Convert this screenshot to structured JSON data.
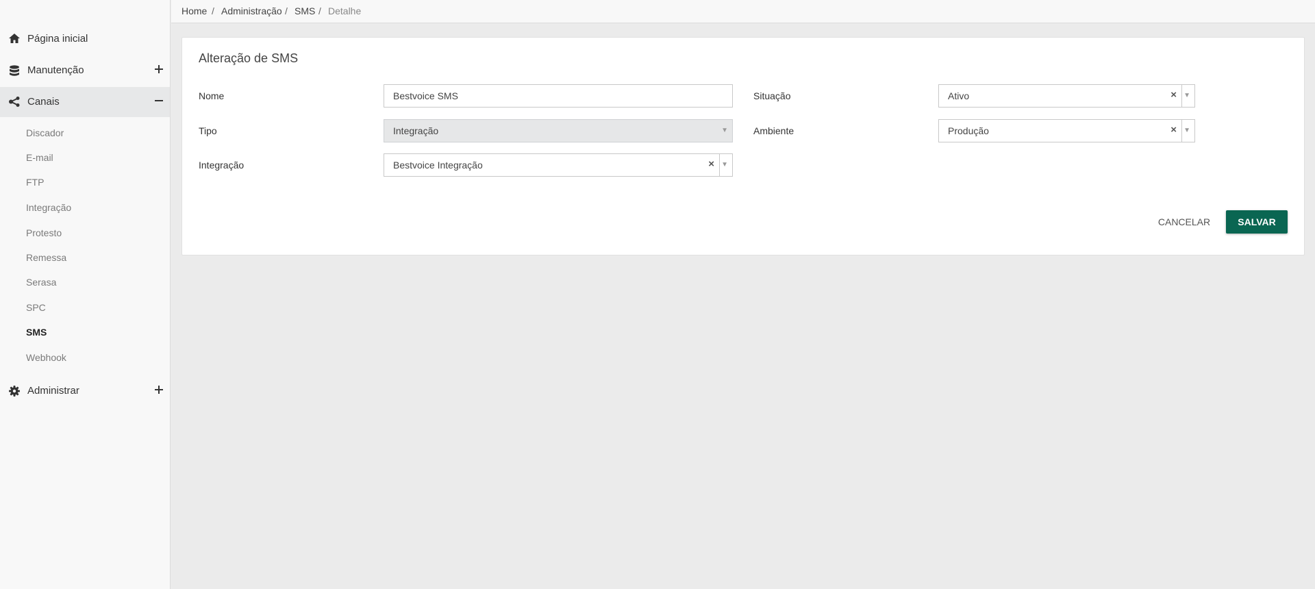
{
  "sidebar": {
    "home": {
      "label": "Página inicial",
      "icon": "home-icon"
    },
    "manutencao": {
      "label": "Manutenção",
      "icon": "database-icon"
    },
    "canais": {
      "label": "Canais",
      "icon": "share-icon"
    },
    "administrar": {
      "label": "Administrar",
      "icon": "gear-icon"
    },
    "canais_items": [
      "Discador",
      "E-mail",
      "FTP",
      "Integração",
      "Protesto",
      "Remessa",
      "Serasa",
      "SPC",
      "SMS",
      "Webhook"
    ],
    "active_item": "SMS"
  },
  "breadcrumb": [
    "Home",
    "Administração",
    "SMS",
    "Detalhe"
  ],
  "form": {
    "title": "Alteração de SMS",
    "nome_label": "Nome",
    "nome_value": "Bestvoice SMS",
    "tipo_label": "Tipo",
    "tipo_value": "Integração",
    "integracao_label": "Integração",
    "integracao_value": "Bestvoice Integração",
    "situacao_label": "Situação",
    "situacao_value": "Ativo",
    "ambiente_label": "Ambiente",
    "ambiente_value": "Produção",
    "cancel_label": "CANCELAR",
    "save_label": "SALVAR"
  },
  "colors": {
    "primary": "#0a6652",
    "active_bg": "#e7e8e9"
  }
}
